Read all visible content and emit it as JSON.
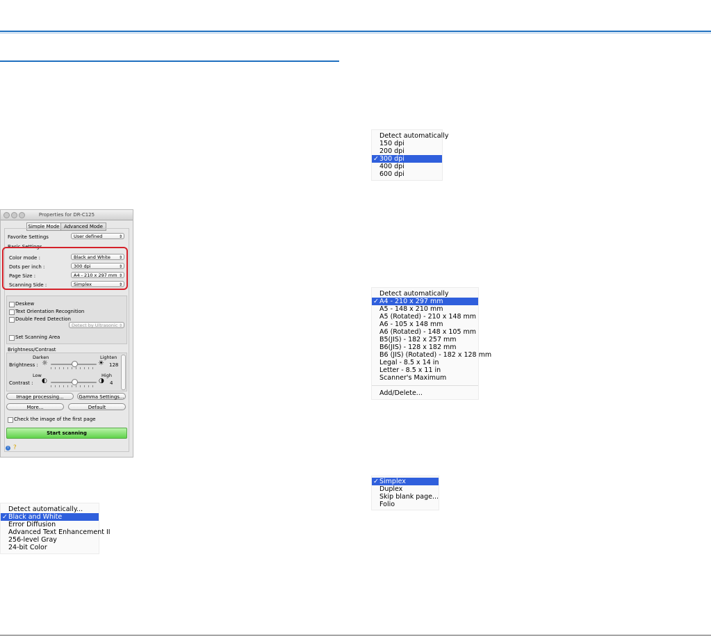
{
  "dialog": {
    "title": "Properties for DR-C125",
    "tabs": [
      "Simple Mode",
      "Advanced Mode"
    ],
    "favorite_label": "Favorite Settings",
    "favorite_value": "User defined",
    "basic_settings_label": "Basic Settings",
    "color_mode_label": "Color mode :",
    "color_mode_value": "Black and White",
    "dpi_label": "Dots per inch :",
    "dpi_value": "300 dpi",
    "page_size_label": "Page Size :",
    "page_size_value": "A4 - 210 x 297 mm",
    "scanning_side_label": "Scanning Side :",
    "scanning_side_value": "Simplex",
    "deskew": "Deskew",
    "text_orientation": "Text Orientation Recognition",
    "double_feed": "Double Feed Detection",
    "double_feed_value": "Detect by Ultrasonic",
    "set_scanning_area": "Set Scanning Area",
    "brightness_contrast_label": "Brightness/Contrast",
    "darken": "Darken",
    "lighten": "Lighten",
    "brightness_label": "Brightness :",
    "brightness_value": "128",
    "brightness_level": 0.5,
    "low": "Low",
    "high": "High",
    "contrast_label": "Contrast :",
    "contrast_value": "4",
    "contrast_level": 0.5,
    "image_processing_button": "Image processing...",
    "gamma_button": "Gamma Settings...",
    "more_button": "More...",
    "default_button": "Default",
    "check_first_page": "Check the image of the first page",
    "start_button": "Start scanning"
  },
  "color_menu": {
    "items": [
      "Detect automatically...",
      "Black and White",
      "Error Diffusion",
      "Advanced Text Enhancement II",
      "256-level Gray",
      "24-bit Color"
    ],
    "selected": 1
  },
  "dpi_menu": {
    "items": [
      "Detect automatically",
      "150 dpi",
      "200 dpi",
      "300 dpi",
      "400 dpi",
      "600 dpi"
    ],
    "selected": 3
  },
  "page_size_menu": {
    "items": [
      "Detect automatically",
      "A4 - 210 x 297 mm",
      "A5 - 148 x 210 mm",
      "A5 (Rotated) - 210 x 148 mm",
      "A6 - 105 x 148 mm",
      "A6 (Rotated) - 148 x 105 mm",
      "B5(JIS) - 182 x 257 mm",
      "B6(JIS) - 128 x 182 mm",
      "B6 (JIS) (Rotated) - 182 x 128 mm",
      "Legal - 8.5 x 14 in",
      "Letter - 8.5 x 11 in",
      "Scanner's Maximum"
    ],
    "selected": 1,
    "extra": "Add/Delete..."
  },
  "side_menu": {
    "items": [
      "Simplex",
      "Duplex",
      "Skip blank page...",
      "Folio"
    ],
    "selected": 0
  },
  "checkmark": "✓",
  "colors": {
    "rule": "#1f6fbf",
    "highlight": "#d4212a",
    "selection": "#2f5fdc",
    "start": "#5fd24a"
  }
}
